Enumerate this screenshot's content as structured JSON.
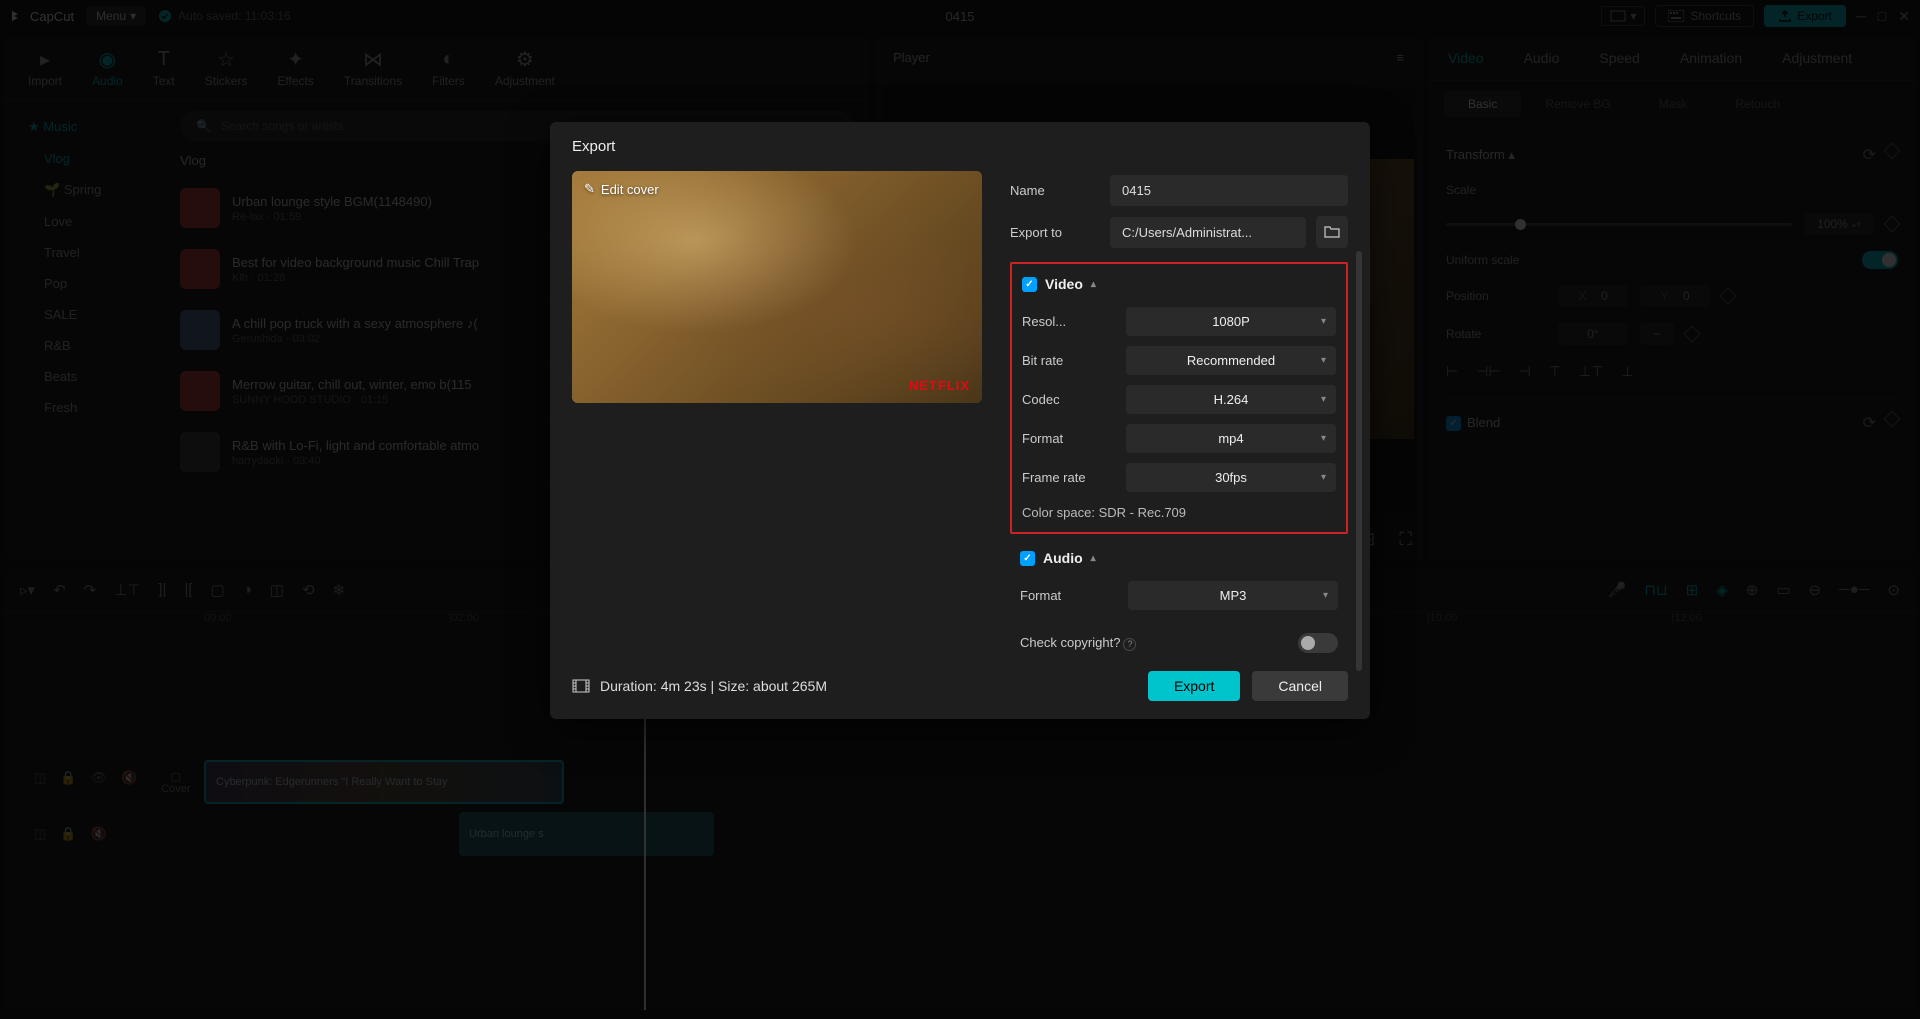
{
  "topbar": {
    "app_name": "CapCut",
    "menu": "Menu",
    "autosave": "Auto saved: 11:03:16",
    "title": "0415",
    "shortcuts": "Shortcuts",
    "export": "Export"
  },
  "top_tabs": [
    "Import",
    "Audio",
    "Text",
    "Stickers",
    "Effects",
    "Transitions",
    "Filters",
    "Adjustment"
  ],
  "top_tabs_active": 1,
  "sidebar": {
    "items": [
      "Music",
      "Vlog",
      "Spring",
      "Love",
      "Travel",
      "Pop",
      "SALE",
      "R&B",
      "Beats",
      "Fresh"
    ],
    "active": 0,
    "sub_active": 1
  },
  "search_placeholder": "Search songs or artists",
  "section_label": "Vlog",
  "tracks": [
    {
      "name": "Urban lounge style BGM(1148490)",
      "meta": "Re-lax · 01:59",
      "thumb": "#c43a3a"
    },
    {
      "name": "Best for video background music Chill Trap",
      "meta": "Klh · 01:28",
      "thumb": "#c43a3a"
    },
    {
      "name": "A chill pop truck with a sexy atmosphere ♪(",
      "meta": "Gerushida · 03:02",
      "thumb": "#4a6a9a"
    },
    {
      "name": "Merrow guitar, chill out, winter, emo b(115",
      "meta": "SUNNY HOOD STUDIO · 01:15",
      "thumb": "#c43a3a"
    },
    {
      "name": "R&B with Lo-Fi, light and comfortable atmo",
      "meta": "harrydaoki · 03:40",
      "thumb": "#3a3a3a"
    }
  ],
  "player": {
    "title": "Player"
  },
  "props": {
    "tabs": [
      "Video",
      "Audio",
      "Speed",
      "Animation",
      "Adjustment"
    ],
    "tabs_active": 0,
    "sub_tabs": [
      "Basic",
      "Remove BG",
      "Mask",
      "Retouch"
    ],
    "sub_active": 0,
    "transform_label": "Transform",
    "scale_label": "Scale",
    "scale_value": "100%",
    "uniform_label": "Uniform scale",
    "position_label": "Position",
    "pos_x_label": "X",
    "pos_x": "0",
    "pos_y_label": "Y",
    "pos_y": "0",
    "rotate_label": "Rotate",
    "rotate_value": "0°",
    "blend_label": "Blend"
  },
  "timeline": {
    "ticks": [
      "00:00",
      "|02:00",
      "",
      "",
      "",
      "|10:00",
      "|12:00"
    ],
    "clip_video": "Cyberpunk:   Edgerunners     \"I Really Want to Stay",
    "clip_audio": "Urban lounge s",
    "cover_label": "Cover"
  },
  "export_modal": {
    "title": "Export",
    "edit_cover": "Edit cover",
    "name_label": "Name",
    "name_value": "0415",
    "export_to_label": "Export to",
    "export_to_value": "C:/Users/Administrat...",
    "video_label": "Video",
    "audio_label": "Audio",
    "rows": {
      "resolution": {
        "label": "Resol...",
        "value": "1080P"
      },
      "bitrate": {
        "label": "Bit rate",
        "value": "Recommended"
      },
      "codec": {
        "label": "Codec",
        "value": "H.264"
      },
      "format": {
        "label": "Format",
        "value": "mp4"
      },
      "framerate": {
        "label": "Frame rate",
        "value": "30fps"
      },
      "colorspace": "Color space: SDR - Rec.709",
      "aformat": {
        "label": "Format",
        "value": "MP3"
      }
    },
    "copyright": "Check copyright?",
    "duration": "Duration: 4m 23s | Size: about 265M",
    "export_btn": "Export",
    "cancel_btn": "Cancel",
    "badge": "NETFLIX"
  }
}
